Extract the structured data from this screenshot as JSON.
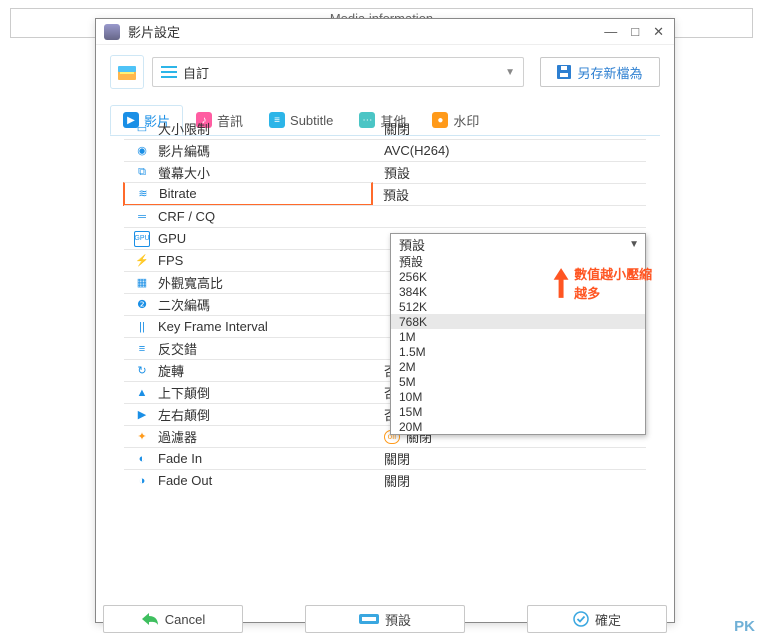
{
  "bg_title": "Media information",
  "dialog": {
    "title": "影片設定",
    "preset_selected": "自訂",
    "save_as_label": "另存新檔為"
  },
  "tabs": [
    {
      "label": "影片"
    },
    {
      "label": "音訊"
    },
    {
      "label": "Subtitle"
    },
    {
      "label": "其他"
    },
    {
      "label": "水印"
    }
  ],
  "rows": [
    {
      "icon": "size-limit-icon",
      "label": "大小限制",
      "value": "關閉"
    },
    {
      "icon": "codec-icon",
      "label": "影片編碼",
      "value": "AVC(H264)"
    },
    {
      "icon": "screen-size-icon",
      "label": "螢幕大小",
      "value": "預設"
    },
    {
      "icon": "bitrate-icon",
      "label": "Bitrate",
      "value": "預設",
      "highlight": true
    },
    {
      "icon": "crf-icon",
      "label": "CRF / CQ",
      "value": ""
    },
    {
      "icon": "gpu-icon",
      "label": "GPU",
      "value": ""
    },
    {
      "icon": "fps-icon",
      "label": "FPS",
      "value": ""
    },
    {
      "icon": "aspect-icon",
      "label": "外觀寬高比",
      "value": ""
    },
    {
      "icon": "two-pass-icon",
      "label": "二次編碼",
      "value": ""
    },
    {
      "icon": "keyframe-icon",
      "label": "Key Frame Interval",
      "value": ""
    },
    {
      "icon": "deinterlace-icon",
      "label": "反交錯",
      "value": ""
    },
    {
      "icon": "rotate-icon",
      "label": "旋轉",
      "value": "否"
    },
    {
      "icon": "flip-v-icon",
      "label": "上下顛倒",
      "value": "否"
    },
    {
      "icon": "flip-h-icon",
      "label": "左右顛倒",
      "value": "否"
    },
    {
      "icon": "filter-icon",
      "label": "過濾器",
      "value": "關閉",
      "off": true
    },
    {
      "icon": "fade-in-icon",
      "label": "Fade In",
      "value": "關閉"
    },
    {
      "icon": "fade-out-icon",
      "label": "Fade Out",
      "value": "關閉"
    }
  ],
  "dropdown": {
    "header": "預設",
    "items": [
      "預設",
      "256K",
      "384K",
      "512K",
      "768K",
      "1M",
      "1.5M",
      "2M",
      "5M",
      "10M",
      "15M",
      "20M"
    ],
    "selected": "768K"
  },
  "annotation": "數值越小壓縮越多",
  "buttons": {
    "cancel": "Cancel",
    "preset": "預設",
    "ok": "確定"
  },
  "watermark": "PK"
}
